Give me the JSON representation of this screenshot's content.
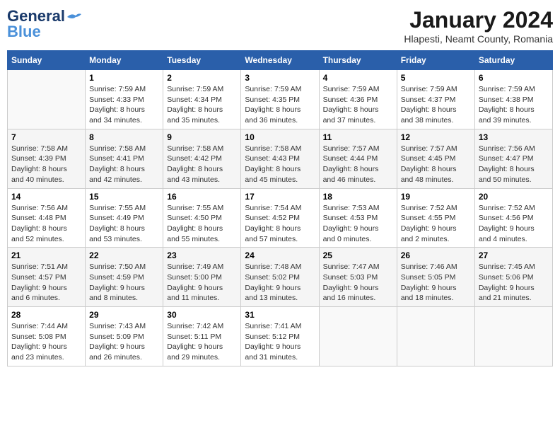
{
  "header": {
    "logo_general": "General",
    "logo_blue": "Blue",
    "month": "January 2024",
    "location": "Hlapesti, Neamt County, Romania"
  },
  "days_of_week": [
    "Sunday",
    "Monday",
    "Tuesday",
    "Wednesday",
    "Thursday",
    "Friday",
    "Saturday"
  ],
  "weeks": [
    [
      {
        "day": "",
        "info": ""
      },
      {
        "day": "1",
        "info": "Sunrise: 7:59 AM\nSunset: 4:33 PM\nDaylight: 8 hours\nand 34 minutes."
      },
      {
        "day": "2",
        "info": "Sunrise: 7:59 AM\nSunset: 4:34 PM\nDaylight: 8 hours\nand 35 minutes."
      },
      {
        "day": "3",
        "info": "Sunrise: 7:59 AM\nSunset: 4:35 PM\nDaylight: 8 hours\nand 36 minutes."
      },
      {
        "day": "4",
        "info": "Sunrise: 7:59 AM\nSunset: 4:36 PM\nDaylight: 8 hours\nand 37 minutes."
      },
      {
        "day": "5",
        "info": "Sunrise: 7:59 AM\nSunset: 4:37 PM\nDaylight: 8 hours\nand 38 minutes."
      },
      {
        "day": "6",
        "info": "Sunrise: 7:59 AM\nSunset: 4:38 PM\nDaylight: 8 hours\nand 39 minutes."
      }
    ],
    [
      {
        "day": "7",
        "info": "Sunrise: 7:58 AM\nSunset: 4:39 PM\nDaylight: 8 hours\nand 40 minutes."
      },
      {
        "day": "8",
        "info": "Sunrise: 7:58 AM\nSunset: 4:41 PM\nDaylight: 8 hours\nand 42 minutes."
      },
      {
        "day": "9",
        "info": "Sunrise: 7:58 AM\nSunset: 4:42 PM\nDaylight: 8 hours\nand 43 minutes."
      },
      {
        "day": "10",
        "info": "Sunrise: 7:58 AM\nSunset: 4:43 PM\nDaylight: 8 hours\nand 45 minutes."
      },
      {
        "day": "11",
        "info": "Sunrise: 7:57 AM\nSunset: 4:44 PM\nDaylight: 8 hours\nand 46 minutes."
      },
      {
        "day": "12",
        "info": "Sunrise: 7:57 AM\nSunset: 4:45 PM\nDaylight: 8 hours\nand 48 minutes."
      },
      {
        "day": "13",
        "info": "Sunrise: 7:56 AM\nSunset: 4:47 PM\nDaylight: 8 hours\nand 50 minutes."
      }
    ],
    [
      {
        "day": "14",
        "info": "Sunrise: 7:56 AM\nSunset: 4:48 PM\nDaylight: 8 hours\nand 52 minutes."
      },
      {
        "day": "15",
        "info": "Sunrise: 7:55 AM\nSunset: 4:49 PM\nDaylight: 8 hours\nand 53 minutes."
      },
      {
        "day": "16",
        "info": "Sunrise: 7:55 AM\nSunset: 4:50 PM\nDaylight: 8 hours\nand 55 minutes."
      },
      {
        "day": "17",
        "info": "Sunrise: 7:54 AM\nSunset: 4:52 PM\nDaylight: 8 hours\nand 57 minutes."
      },
      {
        "day": "18",
        "info": "Sunrise: 7:53 AM\nSunset: 4:53 PM\nDaylight: 9 hours\nand 0 minutes."
      },
      {
        "day": "19",
        "info": "Sunrise: 7:52 AM\nSunset: 4:55 PM\nDaylight: 9 hours\nand 2 minutes."
      },
      {
        "day": "20",
        "info": "Sunrise: 7:52 AM\nSunset: 4:56 PM\nDaylight: 9 hours\nand 4 minutes."
      }
    ],
    [
      {
        "day": "21",
        "info": "Sunrise: 7:51 AM\nSunset: 4:57 PM\nDaylight: 9 hours\nand 6 minutes."
      },
      {
        "day": "22",
        "info": "Sunrise: 7:50 AM\nSunset: 4:59 PM\nDaylight: 9 hours\nand 8 minutes."
      },
      {
        "day": "23",
        "info": "Sunrise: 7:49 AM\nSunset: 5:00 PM\nDaylight: 9 hours\nand 11 minutes."
      },
      {
        "day": "24",
        "info": "Sunrise: 7:48 AM\nSunset: 5:02 PM\nDaylight: 9 hours\nand 13 minutes."
      },
      {
        "day": "25",
        "info": "Sunrise: 7:47 AM\nSunset: 5:03 PM\nDaylight: 9 hours\nand 16 minutes."
      },
      {
        "day": "26",
        "info": "Sunrise: 7:46 AM\nSunset: 5:05 PM\nDaylight: 9 hours\nand 18 minutes."
      },
      {
        "day": "27",
        "info": "Sunrise: 7:45 AM\nSunset: 5:06 PM\nDaylight: 9 hours\nand 21 minutes."
      }
    ],
    [
      {
        "day": "28",
        "info": "Sunrise: 7:44 AM\nSunset: 5:08 PM\nDaylight: 9 hours\nand 23 minutes."
      },
      {
        "day": "29",
        "info": "Sunrise: 7:43 AM\nSunset: 5:09 PM\nDaylight: 9 hours\nand 26 minutes."
      },
      {
        "day": "30",
        "info": "Sunrise: 7:42 AM\nSunset: 5:11 PM\nDaylight: 9 hours\nand 29 minutes."
      },
      {
        "day": "31",
        "info": "Sunrise: 7:41 AM\nSunset: 5:12 PM\nDaylight: 9 hours\nand 31 minutes."
      },
      {
        "day": "",
        "info": ""
      },
      {
        "day": "",
        "info": ""
      },
      {
        "day": "",
        "info": ""
      }
    ]
  ]
}
